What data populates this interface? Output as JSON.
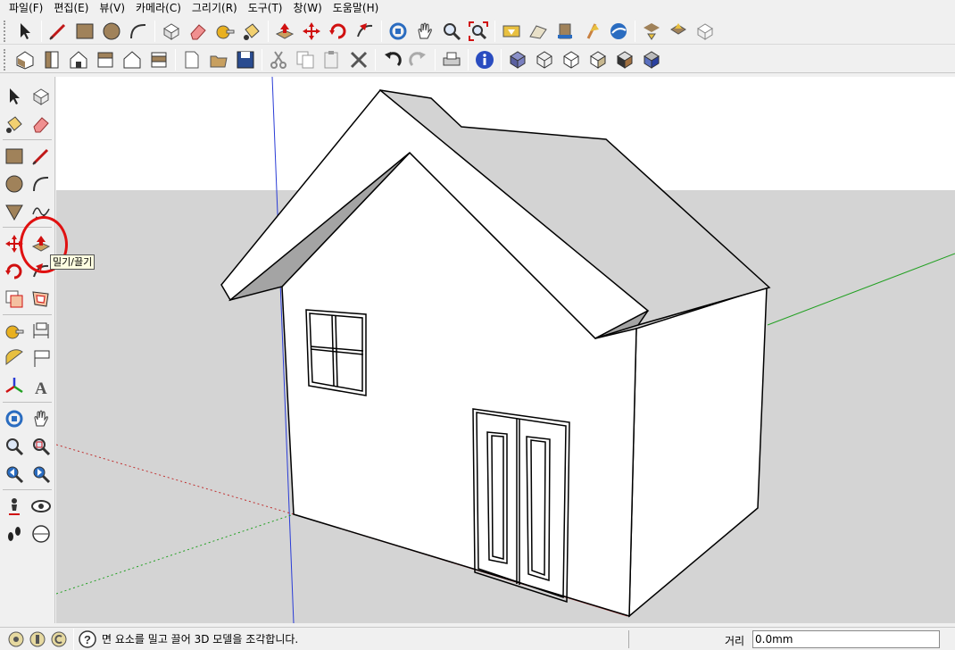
{
  "menu": [
    "파일(F)",
    "편집(E)",
    "뷰(V)",
    "카메라(C)",
    "그리기(R)",
    "도구(T)",
    "창(W)",
    "도움말(H)"
  ],
  "toolbar1": {
    "groups": [
      [
        "select-tool-icon"
      ],
      [
        "pencil-line-icon",
        "rectangle-icon",
        "circle-icon",
        "arc-icon"
      ],
      [
        "make-component-icon",
        "eraser-icon",
        "tape-measure-icon",
        "paint-bucket-icon"
      ],
      [
        "push-pull-icon",
        "move-icon",
        "rotate-icon",
        "follow-me-icon"
      ],
      [
        "orbit-icon",
        "pan-icon",
        "zoom-icon",
        "zoom-extents-icon"
      ],
      [
        "add-location-icon",
        "toggle-terrain-icon",
        "get-models-icon",
        "share-model-icon",
        "google-earth-icon"
      ],
      [
        "get-models-3d-icon",
        "share-component-icon",
        "component-icon"
      ]
    ]
  },
  "toolbar2": {
    "groups": [
      [
        "iso-view-icon",
        "top-view-icon",
        "front-view-icon",
        "right-view-icon",
        "back-view-icon",
        "left-view-icon"
      ],
      [
        "new-file-icon",
        "open-file-icon",
        "save-file-icon"
      ],
      [
        "cut-icon",
        "copy-icon",
        "paste-icon",
        "delete-icon"
      ],
      [
        "undo-icon",
        "redo-icon"
      ],
      [
        "print-icon"
      ],
      [
        "model-info-icon"
      ],
      [
        "xray-icon",
        "wireframe-icon",
        "hidden-line-icon",
        "shaded-icon",
        "shaded-texture-icon",
        "monochrome-icon"
      ]
    ]
  },
  "palette": [
    [
      "select-tool-icon",
      "make-component-icon"
    ],
    [
      "paint-bucket-icon",
      "eraser-icon"
    ],
    "sep",
    [
      "rectangle-icon",
      "pencil-line-icon"
    ],
    [
      "circle-icon",
      "arc-icon"
    ],
    [
      "polygon-icon",
      "freehand-icon"
    ],
    "sep",
    [
      "move-icon",
      "push-pull-icon"
    ],
    [
      "rotate-icon",
      "follow-me-icon"
    ],
    [
      "scale-icon",
      "offset-icon"
    ],
    "sep",
    [
      "tape-measure-icon",
      "dimension-icon"
    ],
    [
      "protractor-icon",
      "text-label-icon"
    ],
    [
      "axes-icon",
      "3d-text-icon"
    ],
    "sep",
    [
      "orbit-icon",
      "pan-icon"
    ],
    [
      "zoom-icon",
      "zoom-window-icon"
    ],
    [
      "previous-view-icon",
      "next-view-icon"
    ],
    "sep",
    [
      "position-camera-icon",
      "look-around-icon"
    ],
    [
      "walk-icon",
      "section-plane-icon"
    ]
  ],
  "tooltip": "밀기/끌기",
  "status": {
    "message": "면 요소를 밀고 끌어 3D 모델을 조각합니다.",
    "measure_label": "거리",
    "measure_value": "0.0mm"
  },
  "colors": {
    "sky": "#ffffff",
    "ground": "#d4d4d4",
    "roof_top": "#d3d3d3",
    "roof_under": "#a4a4a4",
    "wall": "#ffffff",
    "accent_red": "#e01010"
  }
}
